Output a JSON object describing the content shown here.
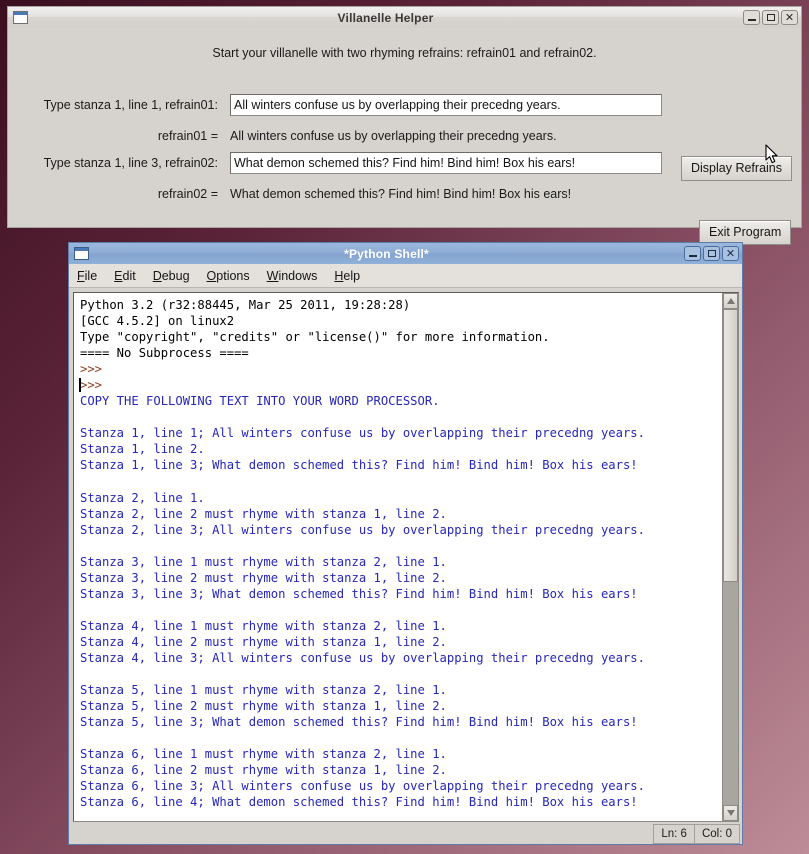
{
  "villanelle": {
    "title": "Villanelle Helper",
    "hint": "Start your villanelle with two rhyming refrains: refrain01 and refrain02.",
    "label_refrain01": "Type stanza 1, line 1, refrain01:",
    "input_refrain01_value": "All winters confuse us by overlapping their precedng years.",
    "input_refrain01_placeholder": "",
    "echo_label_refrain01": "refrain01 =",
    "echo_value_refrain01": "All winters confuse us by overlapping their precedng years.",
    "label_refrain02": "Type stanza 1, line 3, refrain02:",
    "input_refrain02_value": "What demon schemed this? Find him! Bind him! Box his ears!",
    "input_refrain02_placeholder": "",
    "echo_label_refrain02": "refrain02 =",
    "echo_value_refrain02": "What demon schemed this? Find him! Bind him! Box his ears!",
    "display_refrains_label": "Display Refrains",
    "exit_program_label": "Exit Program",
    "window_buttons": {
      "minimize": "minimize-icon",
      "maximize": "maximize-icon",
      "close": "close-icon"
    }
  },
  "shell": {
    "title": "*Python Shell*",
    "menu": [
      {
        "label": "File",
        "accel": "F"
      },
      {
        "label": "Edit",
        "accel": "E"
      },
      {
        "label": "Debug",
        "accel": "D"
      },
      {
        "label": "Options",
        "accel": "O"
      },
      {
        "label": "Windows",
        "accel": "W"
      },
      {
        "label": "Help",
        "accel": "H"
      }
    ],
    "lines": [
      {
        "text": "Python 3.2 (r32:88445, Mar 25 2011, 19:28:28)",
        "kind": "banner"
      },
      {
        "text": "[GCC 4.5.2] on linux2",
        "kind": "banner"
      },
      {
        "text": "Type \"copyright\", \"credits\" or \"license()\" for more information.",
        "kind": "banner"
      },
      {
        "text": "==== No Subprocess ====",
        "kind": "banner"
      },
      {
        "text": ">>>",
        "kind": "prompt"
      },
      {
        "text": ">>>",
        "kind": "prompt",
        "cursor": true
      },
      {
        "text": "COPY THE FOLLOWING TEXT INTO YOUR WORD PROCESSOR.",
        "kind": "out"
      },
      {
        "text": "",
        "kind": "out"
      },
      {
        "text": "Stanza 1, line 1; All winters confuse us by overlapping their precedng years.",
        "kind": "out"
      },
      {
        "text": "Stanza 1, line 2.",
        "kind": "out"
      },
      {
        "text": "Stanza 1, line 3; What demon schemed this? Find him! Bind him! Box his ears!",
        "kind": "out"
      },
      {
        "text": "",
        "kind": "out"
      },
      {
        "text": "Stanza 2, line 1.",
        "kind": "out"
      },
      {
        "text": "Stanza 2, line 2 must rhyme with stanza 1, line 2.",
        "kind": "out"
      },
      {
        "text": "Stanza 2, line 3; All winters confuse us by overlapping their precedng years.",
        "kind": "out"
      },
      {
        "text": "",
        "kind": "out"
      },
      {
        "text": "Stanza 3, line 1 must rhyme with stanza 2, line 1.",
        "kind": "out"
      },
      {
        "text": "Stanza 3, line 2 must rhyme with stanza 1, line 2.",
        "kind": "out"
      },
      {
        "text": "Stanza 3, line 3; What demon schemed this? Find him! Bind him! Box his ears!",
        "kind": "out"
      },
      {
        "text": "",
        "kind": "out"
      },
      {
        "text": "Stanza 4, line 1 must rhyme with stanza 2, line 1.",
        "kind": "out"
      },
      {
        "text": "Stanza 4, line 2 must rhyme with stanza 1, line 2.",
        "kind": "out"
      },
      {
        "text": "Stanza 4, line 3; All winters confuse us by overlapping their precedng years.",
        "kind": "out"
      },
      {
        "text": "",
        "kind": "out"
      },
      {
        "text": "Stanza 5, line 1 must rhyme with stanza 2, line 1.",
        "kind": "out"
      },
      {
        "text": "Stanza 5, line 2 must rhyme with stanza 1, line 2.",
        "kind": "out"
      },
      {
        "text": "Stanza 5, line 3; What demon schemed this? Find him! Bind him! Box his ears!",
        "kind": "out"
      },
      {
        "text": "",
        "kind": "out"
      },
      {
        "text": "Stanza 6, line 1 must rhyme with stanza 2, line 1.",
        "kind": "out"
      },
      {
        "text": "Stanza 6, line 2 must rhyme with stanza 1, line 2.",
        "kind": "out"
      },
      {
        "text": "Stanza 6, line 3; All winters confuse us by overlapping their precedng years.",
        "kind": "out"
      },
      {
        "text": "Stanza 6, line 4; What demon schemed this? Find him! Bind him! Box his ears!",
        "kind": "out"
      }
    ],
    "status": {
      "line": "Ln: 6",
      "column": "Col: 0"
    },
    "window_buttons": {
      "minimize": "minimize-icon",
      "maximize": "maximize-icon",
      "close": "close-icon"
    }
  },
  "colors": {
    "banner_text": "#000000",
    "prompt_text": "#8f3c1c",
    "output_text": "#2727b8",
    "active_titlebar": "#8fadd6",
    "inactive_titlebar": "#e3e1de",
    "window_face": "#d6d3ce",
    "desktop": "#5b2338"
  }
}
